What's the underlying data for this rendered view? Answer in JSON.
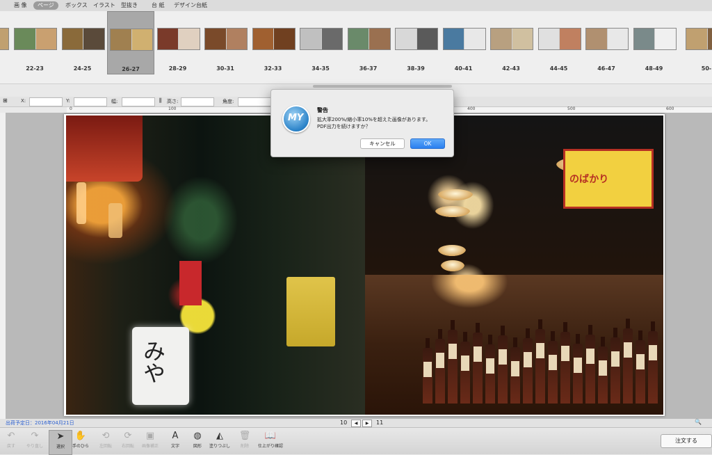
{
  "top_tabs": [
    {
      "label": "画 像",
      "active": false
    },
    {
      "label": "ページ",
      "active": true
    },
    {
      "label": "ボックス",
      "active": false
    },
    {
      "label": "イラスト",
      "active": false
    },
    {
      "label": "型抜き",
      "active": false
    },
    {
      "label": "台 紙",
      "active": false
    },
    {
      "label": "デザイン台紙",
      "active": false
    }
  ],
  "spreads": [
    {
      "label": "22-23",
      "selected": false
    },
    {
      "label": "24-25",
      "selected": false
    },
    {
      "label": "26-27",
      "selected": true
    },
    {
      "label": "28-29",
      "selected": false
    },
    {
      "label": "30-31",
      "selected": false
    },
    {
      "label": "32-33",
      "selected": false
    },
    {
      "label": "34-35",
      "selected": false
    },
    {
      "label": "36-37",
      "selected": false
    },
    {
      "label": "38-39",
      "selected": false
    },
    {
      "label": "40-41",
      "selected": false
    },
    {
      "label": "42-43",
      "selected": false
    },
    {
      "label": "44-45",
      "selected": false
    },
    {
      "label": "46-47",
      "selected": false
    },
    {
      "label": "48-49",
      "selected": false
    },
    {
      "label": "50-",
      "selected": false
    }
  ],
  "inspector": {
    "x_label": "X:",
    "y_label": "Y:",
    "width_label": "幅:",
    "height_label": "高さ:",
    "angle_label": "角度:"
  },
  "ruler": {
    "ticks": [
      "0",
      "100",
      "400",
      "500",
      "600"
    ]
  },
  "canvas": {
    "sign_text": "みや",
    "board_text": "のばかり"
  },
  "dialog": {
    "title": "警告",
    "message_line1": "拡大率200%/縮小率10%を超えた画像があります。",
    "message_line2": "PDF出力を続けますか？",
    "cancel_label": "キャンセル",
    "ok_label": "OK",
    "icon_text": "MY"
  },
  "status": {
    "ship_date": "出荷予定日：2016年04月21日",
    "left_page": "10",
    "right_page": "11"
  },
  "toolbar": {
    "tools": [
      {
        "label": "戻す",
        "icon": "undo-icon",
        "glyph": "↶",
        "enabled": false
      },
      {
        "label": "やり直し",
        "icon": "redo-icon",
        "glyph": "↷",
        "enabled": false
      },
      {
        "label": "選択",
        "icon": "pointer-icon",
        "glyph": "➤",
        "enabled": true,
        "selected": true
      },
      {
        "label": "手のひら",
        "icon": "hand-icon",
        "glyph": "✋",
        "enabled": true
      },
      {
        "label": "左回転",
        "icon": "rotate-left-icon",
        "glyph": "⟲",
        "enabled": false
      },
      {
        "label": "右回転",
        "icon": "rotate-right-icon",
        "glyph": "⟳",
        "enabled": false
      },
      {
        "label": "画像補正",
        "icon": "image-adjust-icon",
        "glyph": "▣",
        "enabled": false
      },
      {
        "label": "文字",
        "icon": "text-icon",
        "glyph": "A",
        "enabled": true
      },
      {
        "label": "図形",
        "icon": "shape-icon",
        "glyph": "◍",
        "enabled": true
      },
      {
        "label": "塗りつぶし",
        "icon": "fill-icon",
        "glyph": "◭",
        "enabled": true
      },
      {
        "label": "削除",
        "icon": "trash-icon",
        "glyph": "🗑",
        "enabled": false
      },
      {
        "label": "仕上がり確認",
        "icon": "book-preview-icon",
        "glyph": "📖",
        "enabled": true
      }
    ],
    "order_label": "注文する"
  }
}
